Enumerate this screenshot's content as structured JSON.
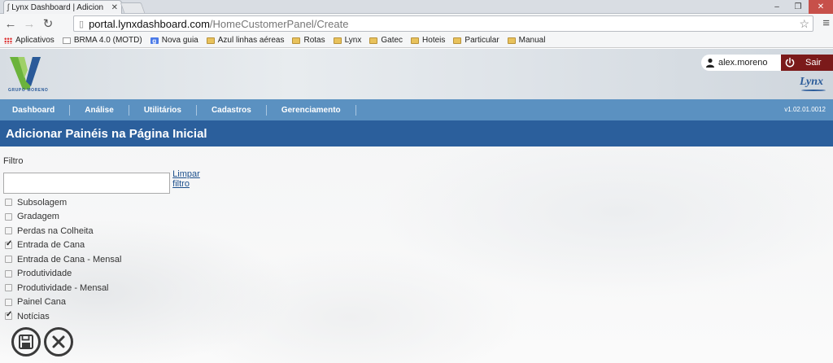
{
  "browser": {
    "tab_title": "Lynx Dashboard | Adicion",
    "url_host": "portal.lynxdashboard.com",
    "url_path": "/HomeCustomerPanel/Create",
    "bookmarks": [
      {
        "label": "Aplicativos",
        "icon": "apps-icon"
      },
      {
        "label": "BRMA 4.0 (MOTD)",
        "icon": "page-icon"
      },
      {
        "label": "Nova guia",
        "icon": "google-icon"
      },
      {
        "label": "Azul linhas aéreas",
        "icon": "folder-icon"
      },
      {
        "label": "Rotas",
        "icon": "folder-icon"
      },
      {
        "label": "Lynx",
        "icon": "folder-icon"
      },
      {
        "label": "Gatec",
        "icon": "folder-icon"
      },
      {
        "label": "Hoteis",
        "icon": "folder-icon"
      },
      {
        "label": "Particular",
        "icon": "folder-icon"
      },
      {
        "label": "Manual",
        "icon": "folder-icon"
      }
    ]
  },
  "header": {
    "logo_text": "GRUPO MORENO",
    "username": "alex.moreno",
    "logout_label": "Sair",
    "brand": "Lynx"
  },
  "nav": {
    "items": [
      "Dashboard",
      "Análise",
      "Utilitários",
      "Cadastros",
      "Gerenciamento"
    ],
    "version": "v1.02.01.0012"
  },
  "page": {
    "title": "Adicionar Painéis na Página Inicial",
    "filter_label": "Filtro",
    "filter_value": "",
    "clear_filter": "Limpar filtro",
    "panels": [
      {
        "label": "Subsolagem",
        "checked": false
      },
      {
        "label": "Gradagem",
        "checked": false
      },
      {
        "label": "Perdas na Colheita",
        "checked": false
      },
      {
        "label": "Entrada de Cana",
        "checked": true
      },
      {
        "label": "Entrada de Cana - Mensal",
        "checked": false
      },
      {
        "label": "Produtividade",
        "checked": false
      },
      {
        "label": "Produtividade - Mensal",
        "checked": false
      },
      {
        "label": "Painel Cana",
        "checked": false
      },
      {
        "label": "Notícias",
        "checked": true
      }
    ]
  },
  "colors": {
    "nav_bar": "#5b91c1",
    "title_bar": "#2b5f9c",
    "logout": "#7b1a1a"
  }
}
